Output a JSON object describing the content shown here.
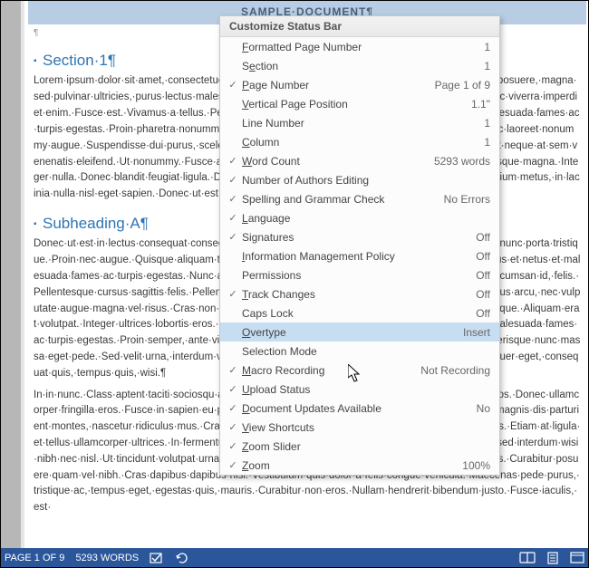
{
  "banner": "SAMPLE·DOCUMENT¶",
  "heading1": "Section·1¶",
  "para1": "Lorem·ipsum·dolor·sit·amet,·consectetuer·adipiscing·elit.·Maecenas·porttitor·congue·massa.·Fusce·posuere,·magna·sed·pulvinar·ultricies,·purus·lectus·malesuada·libero,·sit·amet·commodo·magna·eros·quis·urna.·Nunc·viverra·imperdiet·enim.·Fusce·est.·Vivamus·a·tellus.·Pellentesque·habitant·morbi·tristique·senectus·et·netus·et·malesuada·fames·ac·turpis·egestas.·Proin·pharetra·nonummy·pede.·Mauris·et·orci.·Aenean·nec·lorem.·In·porttitor.·Donec·laoreet·nonummy·augue.·Suspendisse·dui·purus,·scelerisque·at,·vulputate·vitae,·pretium·mattis,·nunc.·Mauris·eget·neque·at·sem·venenatis·eleifend.·Ut·nonummy.·Fusce·aliquet·pede·non·pede.·Suspendisse·dapibus·lorem·pellentesque·magna.·Integer·nulla.·Donec·blandit·feugiat·ligula.·Donec·hendrerit,·felis·et·imperdiet·euismod,·purus·ipsum·pretium·metus,·in·lacinia·nulla·nisl·eget·sapien.·Donec·ut·est·in·lectus·consequat·consequat.¶",
  "heading2": "Subheading·A¶",
  "para2": "Donec·ut·est·in·lectus·consequat·consequat.·Etiam·eget·dui.·Aliquam·erat·volutpat.·Sed·at·lorem·in·nunc·porta·tristique.·Proin·nec·augue.·Quisque·aliquam·tempor·magna.·Pellentesque·habitant·morbi·tristique·senectus·et·netus·et·malesuada·fames·ac·turpis·egestas.·Nunc·ac·magna.·Maecenas·odio·dolor,·vulputate·vel,·auctor·ac,·accumsan·id,·felis.·Pellentesque·cursus·sagittis·felis.·Pellentesque·porttitor,·velit·lacinia·egestas·auctor,·diam·eros·tempus·arcu,·nec·vulputate·augue·magna·vel·risus.·Cras·non·magna·vel·ante·adipiscing·rhoncus.·Vivamus·a·mi.·Morbi·neque.·Aliquam·erat·volutpat.·Integer·ultrices·lobortis·eros.·Pellentesque·habitant·morbi·tristique·senectus·et·netus·et·malesuada·fames·ac·turpis·egestas.·Proin·semper,·ante·vitae·sollicitudin·posuere,·metus·quam·iaculis·nibh,·vitae·scelerisque·nunc·massa·eget·pede.·Sed·velit·urna,·interdum·vel,·ultricies·vel,·faucibus·at,·quam.·Donec·elit·est,·consectetuer·eget,·consequat·quis,·tempus·quis,·wisi.¶",
  "para3": "In·in·nunc.·Class·aptent·taciti·sociosqu·ad·litora·torquent·per·conubia·nostra,·per·inceptos·hymenaeos.·Donec·ullamcorper·fringilla·eros.·Fusce·in·sapien·eu·purus·dapibus·commodo.·Cum·sociis·natoque·penatibus·et·magnis·dis·parturient·montes,·nascetur·ridiculus·mus.·Cras·faucibus·condimentum·odio.·Sed·ac·ligula.·Aliquam·at·eros.·Etiam·at·ligula·et·tellus·ullamcorper·ultrices.·In·fermentum,·lorem·non·cursus·porttitor,·diam·urna·accumsan·lacus,·sed·interdum·wisi·nibh·nec·nisl.·Ut·tincidunt·volutpat·urna.·Mauris·eleifend·nulla·eget·mauris.·Sed·cursus·quam·id·felis.·Curabitur·posuere·quam·vel·nibh.·Cras·dapibus·dapibus·nisl.·Vestibulum·quis·dolor·a·felis·congue·vehicula.·Maecenas·pede·purus,·tristique·ac,·tempus·eget,·egestas·quis,·mauris.·Curabitur·non·eros.·Nullam·hendrerit·bibendum·justo.·Fusce·iaculis,·est·",
  "menu": {
    "title": "Customize Status Bar",
    "items": [
      {
        "check": false,
        "label": "Formatted Page Number",
        "u": "F",
        "val": "1"
      },
      {
        "check": false,
        "label": "Section",
        "u": "e",
        "val": "1"
      },
      {
        "check": true,
        "label": "Page Number",
        "u": "P",
        "val": "Page 1 of 9"
      },
      {
        "check": false,
        "label": "Vertical Page Position",
        "u": "V",
        "val": "1.1\""
      },
      {
        "check": false,
        "label": "Line Number",
        "u": "",
        "val": "1"
      },
      {
        "check": false,
        "label": "Column",
        "u": "C",
        "val": "1"
      },
      {
        "check": true,
        "label": "Word Count",
        "u": "W",
        "val": "5293 words"
      },
      {
        "check": true,
        "label": "Number of Authors Editing",
        "u": "",
        "val": ""
      },
      {
        "check": true,
        "label": "Spelling and Grammar Check",
        "u": "",
        "val": "No Errors"
      },
      {
        "check": true,
        "label": "Language",
        "u": "L",
        "val": ""
      },
      {
        "check": true,
        "label": "Signatures",
        "u": "g",
        "val": "Off"
      },
      {
        "check": false,
        "label": "Information Management Policy",
        "u": "I",
        "val": "Off"
      },
      {
        "check": false,
        "label": "Permissions",
        "u": "",
        "val": "Off"
      },
      {
        "check": true,
        "label": "Track Changes",
        "u": "T",
        "val": "Off"
      },
      {
        "check": false,
        "label": "Caps Lock",
        "u": "",
        "val": "Off"
      },
      {
        "check": false,
        "label": "Overtype",
        "u": "O",
        "val": "Insert",
        "highlight": true
      },
      {
        "check": false,
        "label": "Selection Mode",
        "u": "",
        "val": ""
      },
      {
        "check": true,
        "label": "Macro Recording",
        "u": "M",
        "val": "Not Recording"
      },
      {
        "check": true,
        "label": "Upload Status",
        "u": "U",
        "val": ""
      },
      {
        "check": true,
        "label": "Document Updates Available",
        "u": "D",
        "val": "No"
      },
      {
        "check": true,
        "label": "View Shortcuts",
        "u": "V",
        "val": ""
      },
      {
        "check": true,
        "label": "Zoom Slider",
        "u": "Z",
        "val": ""
      },
      {
        "check": true,
        "label": "Zoom",
        "u": "Z",
        "val": "100%"
      }
    ]
  },
  "statusbar": {
    "page": "PAGE 1 OF 9",
    "words": "5293 WORDS"
  }
}
